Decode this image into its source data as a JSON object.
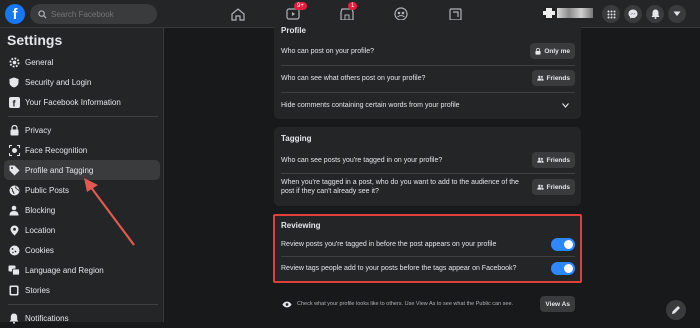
{
  "topbar": {
    "logo": "f",
    "search_placeholder": "Search Facebook",
    "video_badge": "9+",
    "marketplace_badge": "1"
  },
  "sidebar": {
    "title": "Settings",
    "items": [
      {
        "label": "General",
        "icon": "gear-icon"
      },
      {
        "label": "Security and Login",
        "icon": "shield-icon"
      },
      {
        "label": "Your Facebook Information",
        "icon": "facebook-icon"
      },
      {
        "label": "Privacy",
        "icon": "lock-icon"
      },
      {
        "label": "Face Recognition",
        "icon": "face-icon"
      },
      {
        "label": "Profile and Tagging",
        "icon": "tag-icon"
      },
      {
        "label": "Public Posts",
        "icon": "globe-icon"
      },
      {
        "label": "Blocking",
        "icon": "block-icon"
      },
      {
        "label": "Location",
        "icon": "location-icon"
      },
      {
        "label": "Cookies",
        "icon": "cookie-icon"
      },
      {
        "label": "Language and Region",
        "icon": "language-icon"
      },
      {
        "label": "Stories",
        "icon": "stories-icon"
      },
      {
        "label": "Notifications",
        "icon": "bell-icon"
      }
    ]
  },
  "profile": {
    "title": "Profile",
    "rows": [
      {
        "text": "Who can post on your profile?",
        "value": "Only me"
      },
      {
        "text": "Who can see what others post on your profile?",
        "value": "Friends"
      },
      {
        "text": "Hide comments containing certain words from your profile"
      }
    ]
  },
  "tagging": {
    "title": "Tagging",
    "rows": [
      {
        "text": "Who can see posts you're tagged in on your profile?",
        "value": "Friends"
      },
      {
        "text": "When you're tagged in a post, who do you want to add to the audience of the post if they can't already see it?",
        "value": "Friends"
      }
    ]
  },
  "reviewing": {
    "title": "Reviewing",
    "rows": [
      {
        "text": "Review posts you're tagged in before the post appears on your profile",
        "enabled": true
      },
      {
        "text": "Review tags people add to your posts before the tags appear on Facebook?",
        "enabled": true
      }
    ]
  },
  "footer": {
    "text": "Check what your profile looks like to others. Use View As to see what the Public can see.",
    "button": "View As"
  },
  "colors": {
    "accent": "#2d88ff",
    "highlight_box": "#e0403a",
    "arrow": "#e05a50"
  }
}
